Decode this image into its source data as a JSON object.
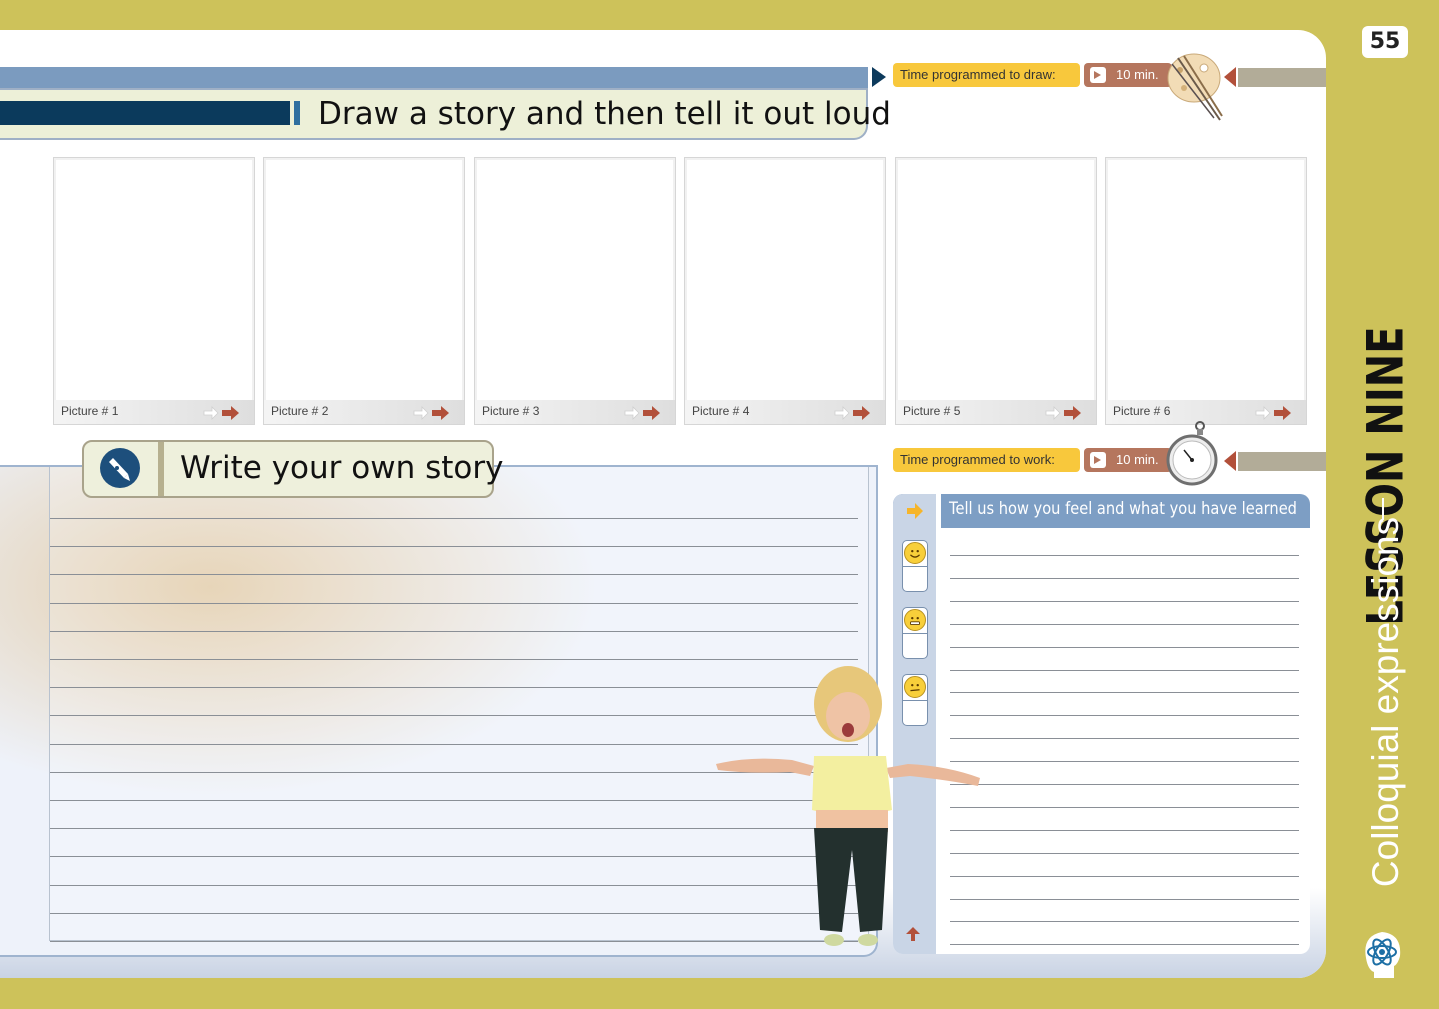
{
  "page_number": "55",
  "lesson": {
    "title": "LESSON NINE",
    "subject": "Colloquial expressions"
  },
  "draw_section": {
    "title": "Draw a story and then tell it out loud",
    "time_label": "Time programmed to draw:",
    "time_value": "10 min."
  },
  "pictures": [
    {
      "label": "Picture # 1"
    },
    {
      "label": "Picture # 2"
    },
    {
      "label": "Picture # 3"
    },
    {
      "label": "Picture # 4"
    },
    {
      "label": "Picture # 5"
    },
    {
      "label": "Picture # 6"
    }
  ],
  "write_section": {
    "title": "Write your own story",
    "line_count": 16
  },
  "feel_section": {
    "time_label": "Time programmed to work:",
    "time_value": "10 min.",
    "title": "Tell us how you feel and what you have learned",
    "line_count": 18,
    "moods": [
      "happy-face-icon",
      "neutral-face-icon",
      "unsure-face-icon"
    ]
  },
  "colors": {
    "background": "#cdc25a",
    "header_blue": "#7b9bbf",
    "dark_navy": "#0b3a5c",
    "time_yellow": "#f8c83c",
    "time_brown": "#b5765e"
  }
}
